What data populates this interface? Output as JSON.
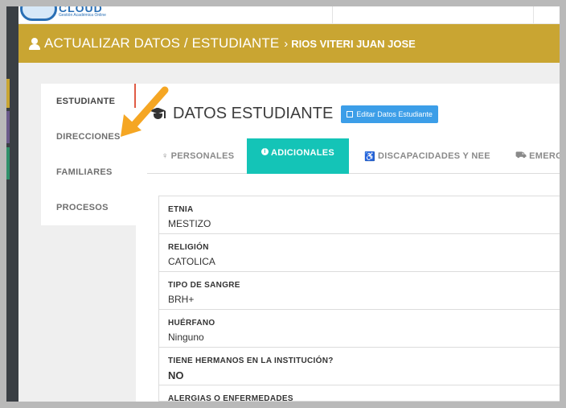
{
  "logo": {
    "word": "CLOUD",
    "tagline": "Gestión Académica Online"
  },
  "header": {
    "title": "ACTUALIZAR DATOS / ESTUDIANTE",
    "separator": "›",
    "student_name": "RIOS VITERI JUAN JOSE"
  },
  "sidenav": {
    "items": [
      {
        "label": "ESTUDIANTE"
      },
      {
        "label": "DIRECCIONES"
      },
      {
        "label": "FAMILIARES"
      },
      {
        "label": "PROCESOS"
      }
    ]
  },
  "section": {
    "title": "DATOS ESTUDIANTE",
    "edit_button": "Editar Datos Estudiante"
  },
  "tabs": [
    {
      "label": "PERSONALES",
      "icon": "person-icon"
    },
    {
      "label": "ADICIONALES",
      "icon": "info-circle-icon"
    },
    {
      "label": "DISCAPACIDADES Y NEE",
      "icon": "wheelchair-icon"
    },
    {
      "label": "EMERG",
      "icon": "ambulance-icon"
    }
  ],
  "fields": [
    {
      "label": "ETNIA",
      "value": "MESTIZO"
    },
    {
      "label": "RELIGIÓN",
      "value": "CATOLICA"
    },
    {
      "label": "TIPO DE SANGRE",
      "value": "BRH+"
    },
    {
      "label": "HUÉRFANO",
      "value": "Ninguno"
    },
    {
      "label": "TIENE HERMANOS EN LA INSTITUCIÓN?",
      "value": "NO"
    },
    {
      "label": "ALERGIAS O ENFERMEDADES",
      "value": ""
    }
  ],
  "colors": {
    "header": "#c9a532",
    "active_tab": "#14c4b7",
    "edit_button": "#3c9ee8",
    "arrow": "#f5a623"
  }
}
